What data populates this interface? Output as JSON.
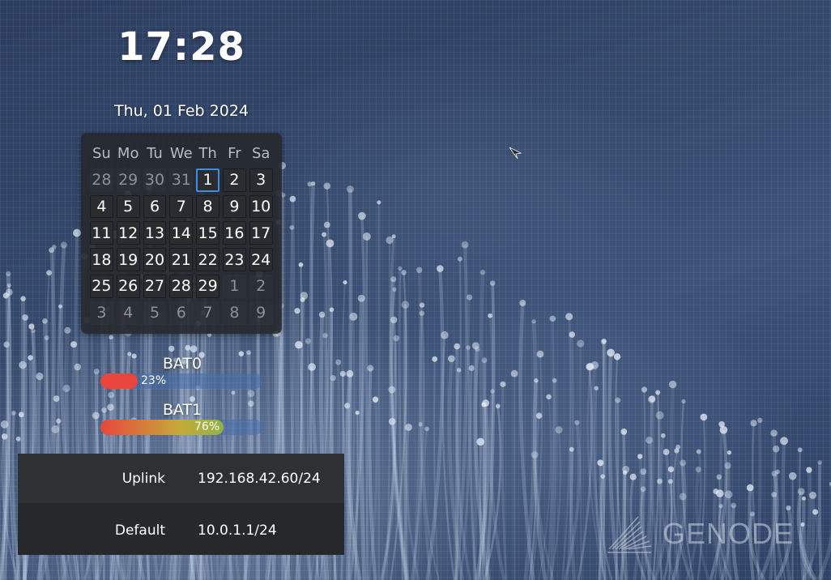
{
  "clock": {
    "time": "17:28"
  },
  "date": {
    "label": "Thu, 01 Feb 2024"
  },
  "calendar": {
    "weekdays": [
      "Su",
      "Mo",
      "Tu",
      "We",
      "Th",
      "Fr",
      "Sa"
    ],
    "weeks": [
      [
        {
          "d": "28",
          "m": "out"
        },
        {
          "d": "29",
          "m": "out"
        },
        {
          "d": "30",
          "m": "out"
        },
        {
          "d": "31",
          "m": "out"
        },
        {
          "d": "1",
          "m": "today"
        },
        {
          "d": "2",
          "m": "in"
        },
        {
          "d": "3",
          "m": "in"
        }
      ],
      [
        {
          "d": "4",
          "m": "in"
        },
        {
          "d": "5",
          "m": "in"
        },
        {
          "d": "6",
          "m": "in"
        },
        {
          "d": "7",
          "m": "in"
        },
        {
          "d": "8",
          "m": "in"
        },
        {
          "d": "9",
          "m": "in"
        },
        {
          "d": "10",
          "m": "in"
        }
      ],
      [
        {
          "d": "11",
          "m": "in"
        },
        {
          "d": "12",
          "m": "in"
        },
        {
          "d": "13",
          "m": "in"
        },
        {
          "d": "14",
          "m": "in"
        },
        {
          "d": "15",
          "m": "in"
        },
        {
          "d": "16",
          "m": "in"
        },
        {
          "d": "17",
          "m": "in"
        }
      ],
      [
        {
          "d": "18",
          "m": "in"
        },
        {
          "d": "19",
          "m": "in"
        },
        {
          "d": "20",
          "m": "in"
        },
        {
          "d": "21",
          "m": "in"
        },
        {
          "d": "22",
          "m": "in"
        },
        {
          "d": "23",
          "m": "in"
        },
        {
          "d": "24",
          "m": "in"
        }
      ],
      [
        {
          "d": "25",
          "m": "in"
        },
        {
          "d": "26",
          "m": "in"
        },
        {
          "d": "27",
          "m": "in"
        },
        {
          "d": "28",
          "m": "in"
        },
        {
          "d": "29",
          "m": "in"
        },
        {
          "d": "1",
          "m": "out"
        },
        {
          "d": "2",
          "m": "out"
        }
      ],
      [
        {
          "d": "3",
          "m": "out"
        },
        {
          "d": "4",
          "m": "out"
        },
        {
          "d": "5",
          "m": "out"
        },
        {
          "d": "6",
          "m": "out"
        },
        {
          "d": "7",
          "m": "out"
        },
        {
          "d": "8",
          "m": "out"
        },
        {
          "d": "9",
          "m": "out"
        }
      ]
    ]
  },
  "batteries": [
    {
      "name": "BAT0",
      "percent_label": "23%",
      "level": 0.23
    },
    {
      "name": "BAT1",
      "percent_label": "76%",
      "level": 0.76
    }
  ],
  "network": {
    "rows": [
      {
        "label": "Uplink",
        "value": "192.168.42.60/24"
      },
      {
        "label": "Default",
        "value": "10.0.1.1/24"
      }
    ]
  },
  "logo": {
    "text": "GENODE"
  },
  "colors": {
    "accent_today": "#3a8ee8",
    "battery_low": "#e8463c",
    "battery_mid": "#c5ab3a",
    "battery_high": "#8fb345",
    "battery_track": "#466eaa"
  }
}
